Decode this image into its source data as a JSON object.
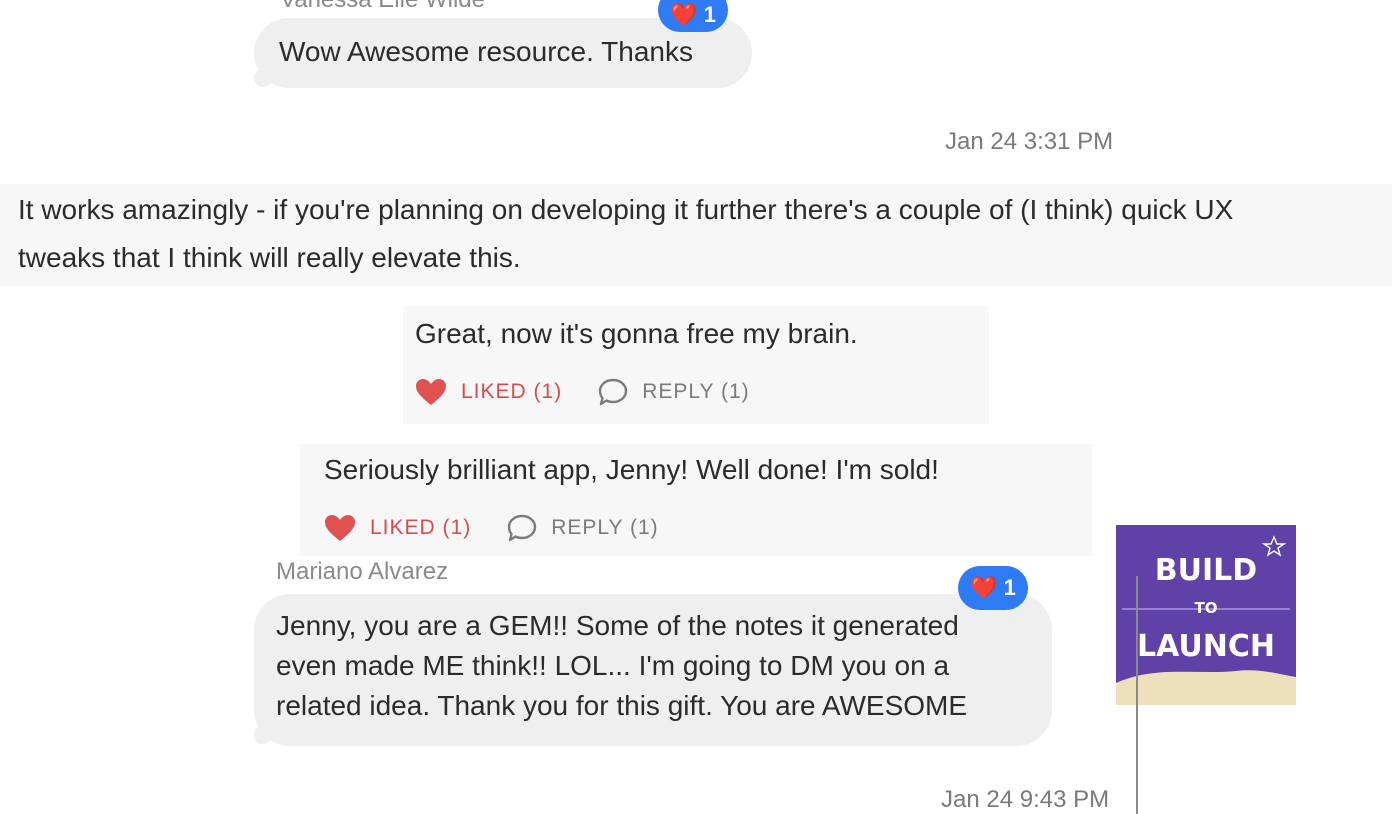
{
  "messages": [
    {
      "author": "Vanessa Elle Wilde",
      "text": "Wow Awesome resource. Thanks",
      "reaction": {
        "emoji": "❤️",
        "count": "1"
      }
    },
    {
      "author": "Mariano Alvarez",
      "text_lines": [
        "Jenny, you are a GEM!! Some of the notes it generated",
        "even made ME think!! LOL... I'm going to DM you on a",
        "related idea. Thank you for this gift. You are AWESOME"
      ],
      "reaction": {
        "emoji": "❤️",
        "count": "1"
      }
    }
  ],
  "timestamps": [
    "Jan 24 3:31 PM",
    "Jan 24 9:43 PM"
  ],
  "banner": {
    "line1": "It works amazingly - if you're planning on developing it further there's a couple of (I think) quick UX",
    "line2": "tweaks that I think will really elevate this."
  },
  "comments": [
    {
      "text": "Great, now it's gonna free my brain.",
      "liked_label": "LIKED (1)",
      "reply_label": "REPLY (1)"
    },
    {
      "text": "Seriously brilliant app, Jenny! Well done! I'm sold!",
      "liked_label": "LIKED (1)",
      "reply_label": "REPLY (1)"
    }
  ],
  "thumbnail": {
    "line1": "BUILD",
    "line2": "TO",
    "line3": "LAUNCH"
  },
  "colors": {
    "reaction_blue": "#2f7bf6",
    "liked_red": "#d84c4c",
    "thumb_purple": "#5f41a8"
  }
}
